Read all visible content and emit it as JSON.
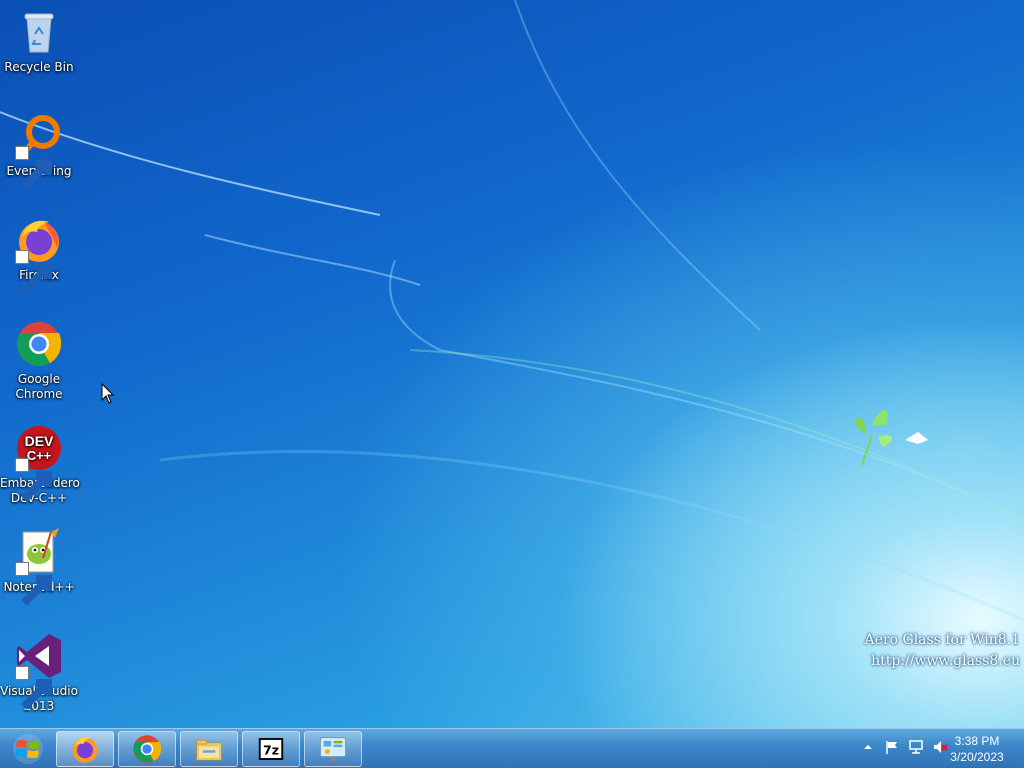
{
  "desktop": {
    "icons": [
      {
        "label": "Recycle Bin",
        "icon": "recycle-bin-icon"
      },
      {
        "label": "Everything",
        "icon": "everything-icon"
      },
      {
        "label": "Firefox",
        "icon": "firefox-icon"
      },
      {
        "label": "Google Chrome",
        "icon": "chrome-icon"
      },
      {
        "label": "Embarcadero Dev-C++",
        "icon": "devcpp-icon"
      },
      {
        "label": "Notepad++",
        "icon": "notepadpp-icon"
      },
      {
        "label": "Visual Studio 2013",
        "icon": "visual-studio-icon"
      }
    ],
    "watermark": {
      "line1": "Aero Glass for Win8.1",
      "line2": "http://www.glass8.eu"
    }
  },
  "taskbar": {
    "start": {
      "icon": "windows-logo-icon"
    },
    "pinned": [
      {
        "icon": "firefox-icon",
        "active": true
      },
      {
        "icon": "chrome-icon",
        "active": false
      },
      {
        "icon": "file-explorer-icon",
        "active": false
      },
      {
        "icon": "7zip-icon",
        "label": "7z",
        "active": false
      },
      {
        "icon": "control-panel-icon",
        "active": false
      }
    ],
    "tray": [
      "show-hidden-icons-arrow",
      "action-center-flag-icon",
      "network-icon",
      "volume-muted-icon"
    ],
    "clock": {
      "time": "3:38 PM",
      "date": "3/20/2023"
    }
  },
  "colors": {
    "taskbar": "#3b85c8",
    "desktop": "#1168cc"
  }
}
